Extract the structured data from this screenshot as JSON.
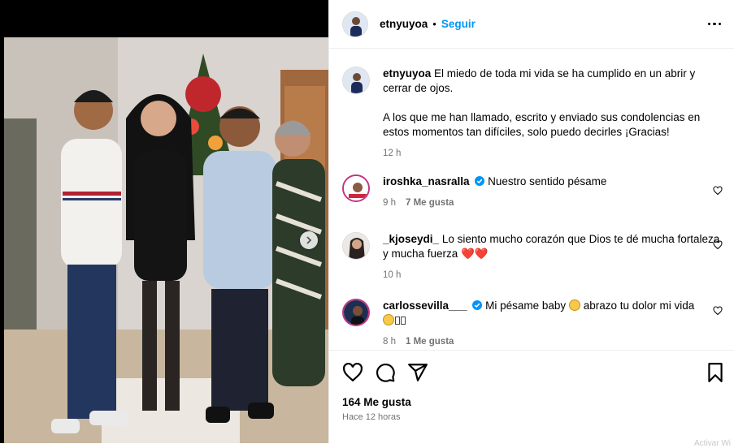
{
  "post": {
    "username": "etnyuyoa",
    "separator": "•",
    "follow_label": "Seguir",
    "more_icon": "more-horizontal-icon"
  },
  "caption": {
    "username": "etnyuyoa",
    "paragraph1": "El miedo de toda mi vida se ha cumplido en un abrir y cerrar de ojos.",
    "paragraph2": "A los que me han llamado, escrito y enviado sus condolencias en estos momentos tan difíciles, solo puedo decirles ¡Gracias!",
    "time": "12 h"
  },
  "comments": [
    {
      "username": "iroshka_nasralla",
      "verified": true,
      "text": "Nuestro sentido pésame",
      "time": "9 h",
      "likes": "7 Me gusta"
    },
    {
      "username": "_kjoseydi_",
      "verified": false,
      "text": "Lo siento mucho corazón que Dios te dé mucha fortaleza y mucha fuerza",
      "emoji": "❤️❤️",
      "time": "10 h"
    },
    {
      "username": "carlossevilla___",
      "verified": true,
      "text": "Mi pésame baby",
      "text2": "abrazo tu dolor mi vida",
      "time": "8 h",
      "likes": "1 Me gusta"
    }
  ],
  "footer": {
    "likes": "164 Me gusta",
    "ago": "Hace 12 horas",
    "partial_text": "Activar Wi"
  },
  "colors": {
    "accent": "#0095f6",
    "muted": "#737373",
    "verified": "#0095f6",
    "heart": "#e0245e"
  }
}
